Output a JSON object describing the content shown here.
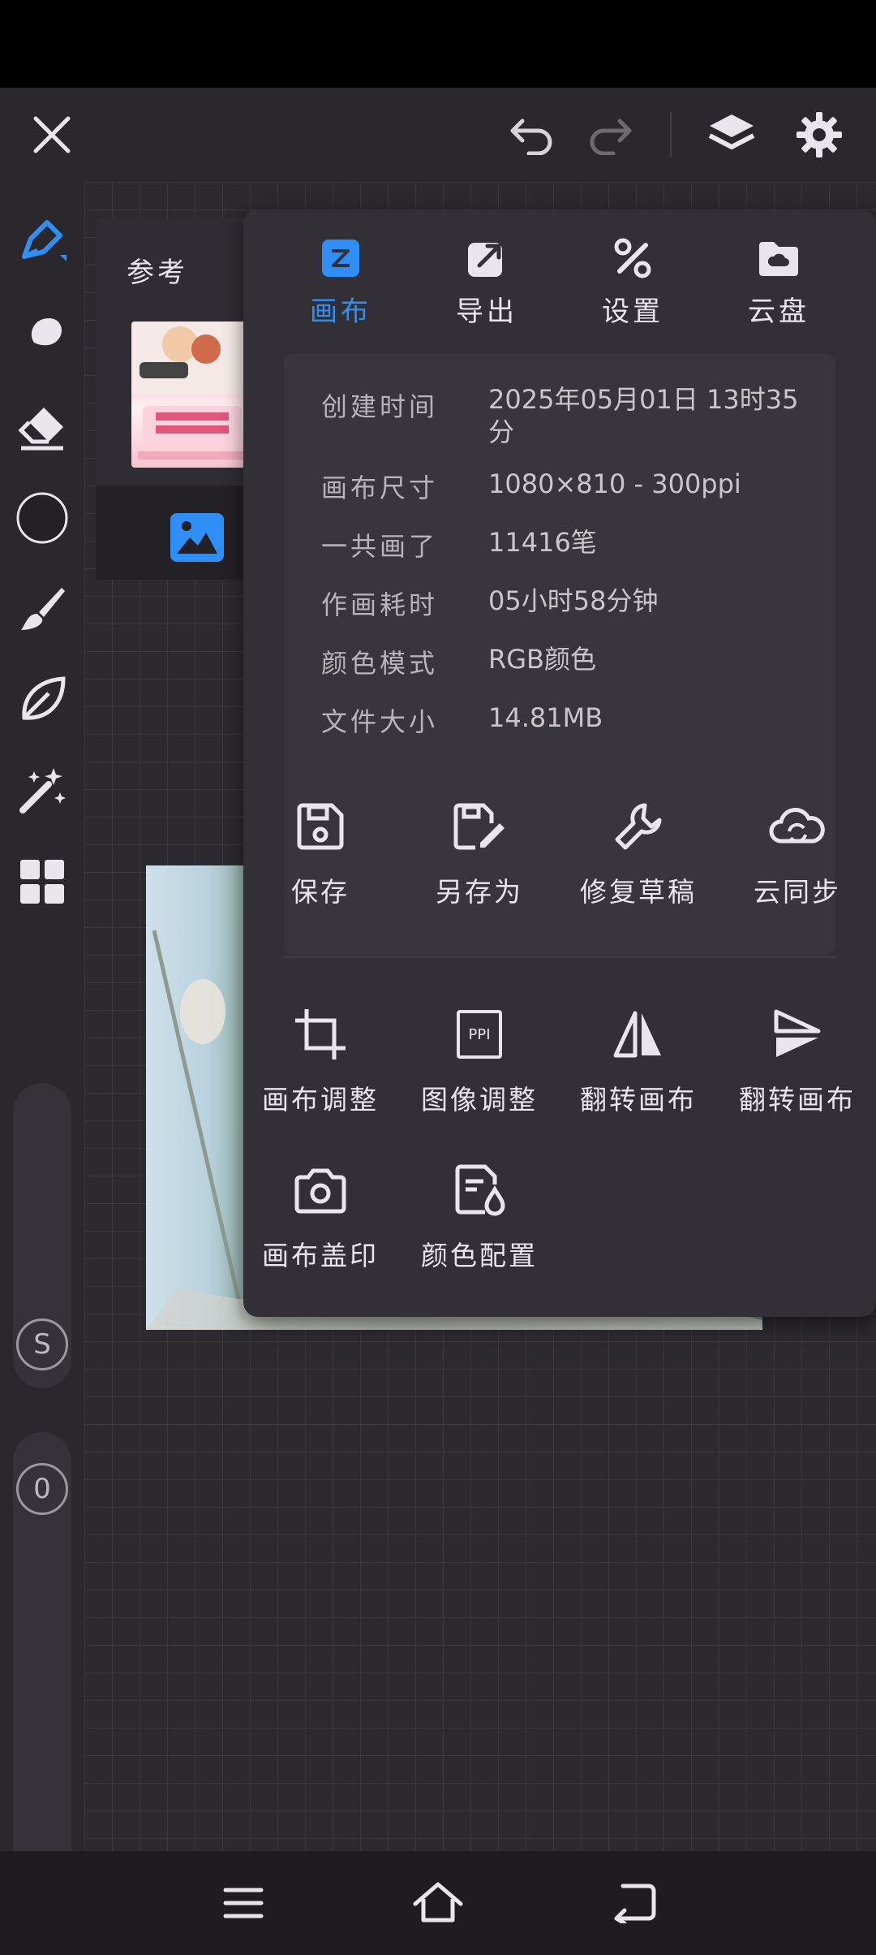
{
  "colors": {
    "accent": "#2f8ff4",
    "panel": "#322f36",
    "text": "#e8e6ec",
    "muted": "#b7b4ba"
  },
  "left_toolbar": {
    "tools": [
      "pen-icon",
      "smudge-icon",
      "eraser-icon",
      "color-circle-icon",
      "brush-icon",
      "leaf-icon",
      "magic-wand-icon",
      "grid-icon"
    ],
    "slider_size_label": "S",
    "slider_opacity_label": "0"
  },
  "reference": {
    "title": "参考"
  },
  "menu": {
    "tabs": [
      {
        "label": "画布",
        "icon": "canvas-icon",
        "active": true
      },
      {
        "label": "导出",
        "icon": "export-icon",
        "active": false
      },
      {
        "label": "设置",
        "icon": "settings-tools-icon",
        "active": false
      },
      {
        "label": "云盘",
        "icon": "cloud-drive-icon",
        "active": false
      }
    ],
    "info": [
      {
        "key": "创建时间",
        "value": "2025年05月01日 13时35分"
      },
      {
        "key": "画布尺寸",
        "value": "1080×810 - 300ppi"
      },
      {
        "key": "一共画了",
        "value": "11416笔"
      },
      {
        "key": "作画耗时",
        "value": "05小时58分钟"
      },
      {
        "key": "颜色模式",
        "value": "RGB颜色"
      },
      {
        "key": "文件大小",
        "value": "14.81MB"
      }
    ],
    "actions_row1": [
      {
        "label": "保存",
        "icon": "save-icon"
      },
      {
        "label": "另存为",
        "icon": "save-as-icon"
      },
      {
        "label": "修复草稿",
        "icon": "wrench-icon"
      },
      {
        "label": "云同步",
        "icon": "cloud-sync-icon"
      }
    ],
    "actions_row2": [
      {
        "label": "画布调整",
        "icon": "crop-icon"
      },
      {
        "label": "图像调整",
        "icon": "ppi-icon",
        "badge": "PPI"
      },
      {
        "label": "翻转画布",
        "icon": "flip-horizontal-icon"
      },
      {
        "label": "翻转画布",
        "icon": "flip-vertical-icon"
      }
    ],
    "actions_row3": [
      {
        "label": "画布盖印",
        "icon": "camera-icon"
      },
      {
        "label": "颜色配置",
        "icon": "color-config-icon"
      }
    ]
  }
}
